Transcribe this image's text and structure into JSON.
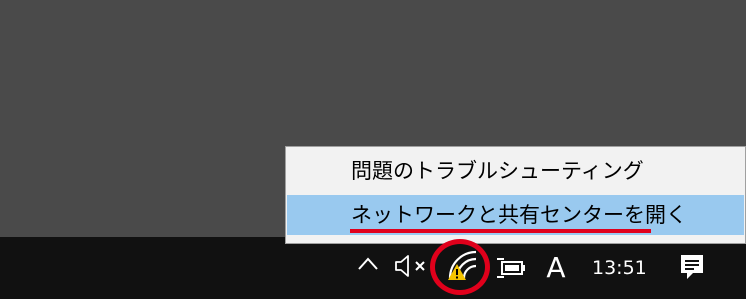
{
  "context_menu": {
    "items": [
      {
        "label": "問題のトラブルシューティング",
        "highlighted": false
      },
      {
        "label": "ネットワークと共有センターを開く",
        "highlighted": true
      }
    ]
  },
  "taskbar": {
    "tray_icons": [
      "chevron-up-icon",
      "speaker-muted-icon",
      "wifi-warning-icon",
      "battery-charging-icon"
    ],
    "ime_indicator": "A",
    "clock": "13:51",
    "action_center_icon": "notification-icon"
  },
  "annotations": {
    "color": "#e0001b"
  },
  "colors": {
    "desktop": "#4a4a4a",
    "taskbar": "#111111",
    "menu_background": "#f2f2f2",
    "menu_highlight": "#99c9ef",
    "warning": "#f5c400"
  }
}
